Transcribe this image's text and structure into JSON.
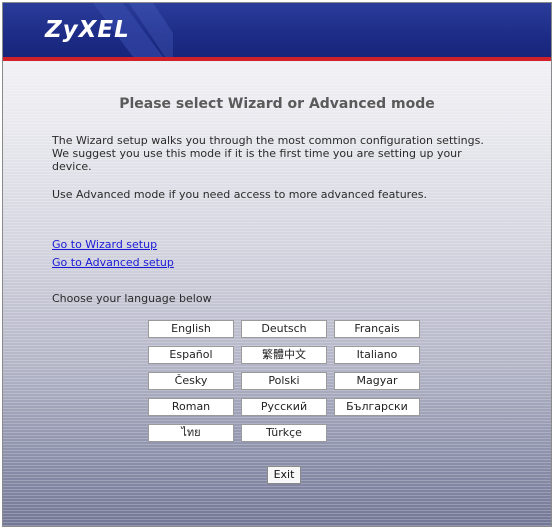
{
  "header": {
    "logo": "ZyXEL",
    "colors": {
      "banner": "#1d2c86",
      "accent": "#d0202a"
    }
  },
  "main": {
    "title": "Please select Wizard or Advanced mode",
    "wizard_desc_line1": "The Wizard setup walks you through the most common configuration settings.",
    "wizard_desc_line2": "We suggest you use this mode if it is the first time you are setting up your",
    "wizard_desc_line3": "device.",
    "advanced_desc": "Use Advanced mode if you need access to more advanced features.",
    "wizard_link": "Go to Wizard setup",
    "advanced_link": "Go to Advanced setup",
    "language_prompt": "Choose your language below",
    "languages": [
      "English",
      "Deutsch",
      "Français",
      "Español",
      "繁體中文",
      "Italiano",
      "Česky",
      "Polski",
      "Magyar",
      "Roman",
      "Русский",
      "Български",
      "ไทย",
      "Türkçe"
    ],
    "exit_label": "Exit",
    "link_color": "#1a1ad6"
  }
}
